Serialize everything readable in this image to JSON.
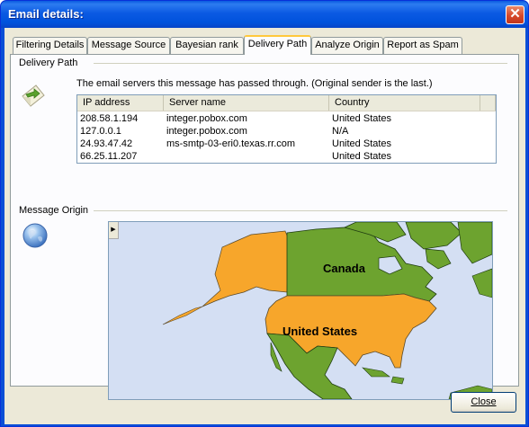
{
  "window": {
    "title": "Email details:",
    "close_glyph": "✕"
  },
  "tabs": [
    {
      "label": "Filtering Details"
    },
    {
      "label": "Message Source"
    },
    {
      "label": "Bayesian rank"
    },
    {
      "label": "Delivery Path"
    },
    {
      "label": "Analyze Origin"
    },
    {
      "label": "Report as Spam"
    }
  ],
  "delivery_path": {
    "group_label": "Delivery Path",
    "icon": "envelope-arrow-icon",
    "description": "The email servers this message has passed through. (Original sender is the last.)",
    "columns": [
      "IP address",
      "Server name",
      "Country"
    ],
    "rows": [
      {
        "ip": "208.58.1.194",
        "server": "integer.pobox.com",
        "country": "United States"
      },
      {
        "ip": "127.0.0.1",
        "server": "integer.pobox.com",
        "country": "N/A"
      },
      {
        "ip": "24.93.47.42",
        "server": "ms-smtp-03-eri0.texas.rr.com",
        "country": "United States"
      },
      {
        "ip": "66.25.11.207",
        "server": "",
        "country": "United States"
      }
    ]
  },
  "message_origin": {
    "group_label": "Message Origin",
    "icon": "globe-icon",
    "map_labels": {
      "canada": "Canada",
      "us": "United States"
    },
    "colors": {
      "highlight": "#f7a62b",
      "land": "#6da32f",
      "water": "#d4dff3"
    }
  },
  "footer": {
    "close_label": "Close"
  }
}
